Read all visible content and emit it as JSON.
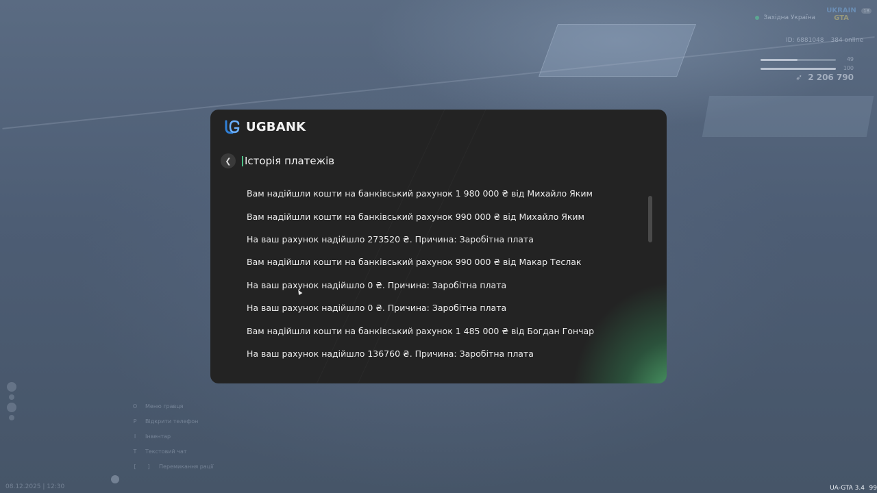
{
  "hud": {
    "server_name": "Західна Україна",
    "logo_line1": "UKRAIN",
    "logo_line2": "GTA",
    "badge": "18",
    "player_id": "ID: 6881048",
    "online": "384 online",
    "hunger_value": "49",
    "hunger_fraction": 0.49,
    "health_value": "100",
    "health_fraction": 1.0,
    "money": "2 206 790"
  },
  "hints": [
    {
      "key": "O",
      "label": "Меню гравця"
    },
    {
      "key": "P",
      "label": "Відкрити телефон"
    },
    {
      "key": "I",
      "label": "Інвентар"
    },
    {
      "key": "T",
      "label": "Текстовий чат"
    },
    {
      "key": "[",
      "key2": "]",
      "label": "Перемикання рації"
    }
  ],
  "footer": {
    "date_time": "08.12.2025 | 12:30",
    "version": "UA-GTA 3.4",
    "fps": "99"
  },
  "bank": {
    "brand": "UGBANK",
    "back_icon": "chevron-left-icon",
    "section_title": "Історія платежів",
    "accent_color": "#4fc087",
    "transactions": [
      "Вам надійшли кошти на банківський рахунок 1 980 000 ₴ від Михайло Яким",
      "Вам надійшли кошти на банківський рахунок 990 000 ₴ від Михайло Яким",
      "На ваш рахунок надійшло 273520 ₴. Причина: Заробітна плата",
      "Вам надійшли кошти на банківський рахунок 990 000 ₴ від Макар Теслак",
      "На ваш рахунок надійшло 0 ₴. Причина: Заробітна плата",
      "На ваш рахунок надійшло 0 ₴. Причина: Заробітна плата",
      "Вам надійшли кошти на банківський рахунок 1 485 000 ₴ від Богдан Гончар",
      "На ваш рахунок надійшло 136760 ₴. Причина: Заробітна плата"
    ]
  }
}
